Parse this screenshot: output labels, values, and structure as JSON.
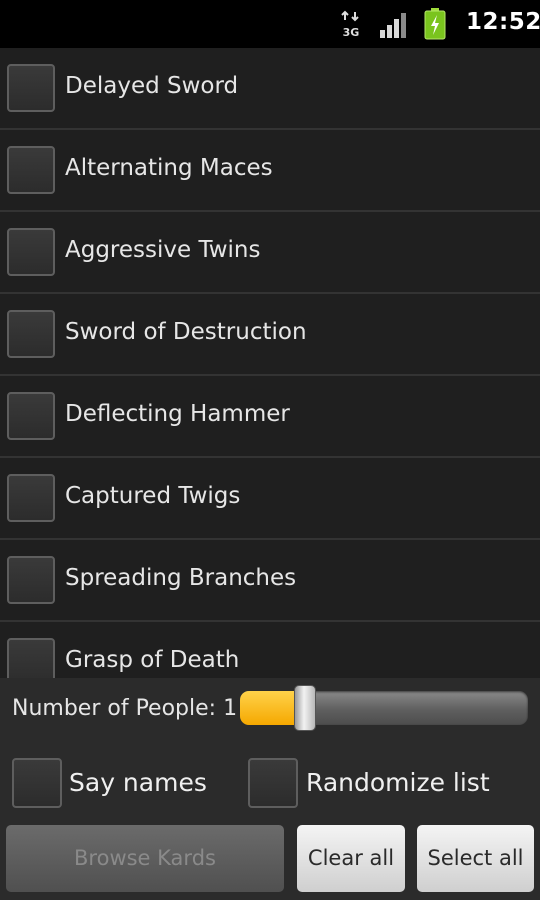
{
  "status_bar": {
    "network_type": "3G",
    "time": "12:52",
    "icons": [
      "data-transfer-3g-icon",
      "signal-strength-icon",
      "battery-charging-icon"
    ]
  },
  "card_list": {
    "items": [
      {
        "label": "Delayed Sword",
        "checked": false
      },
      {
        "label": "Alternating Maces",
        "checked": false
      },
      {
        "label": "Aggressive Twins",
        "checked": false
      },
      {
        "label": "Sword of Destruction",
        "checked": false
      },
      {
        "label": "Deflecting Hammer",
        "checked": false
      },
      {
        "label": "Captured Twigs",
        "checked": false
      },
      {
        "label": "Spreading Branches",
        "checked": false
      },
      {
        "label": "Grasp of Death",
        "checked": false
      }
    ]
  },
  "controls": {
    "people_label": "Number of People: 1",
    "slider_value_fraction": 0.2,
    "say_names_label": "Say names",
    "say_names_checked": false,
    "randomize_label": "Randomize list",
    "randomize_checked": false
  },
  "buttons": {
    "browse": "Browse Kards",
    "clear": "Clear all",
    "select": "Select all"
  },
  "colors": {
    "accent_slider": "#f5a800",
    "background": "#1f1f1f"
  }
}
